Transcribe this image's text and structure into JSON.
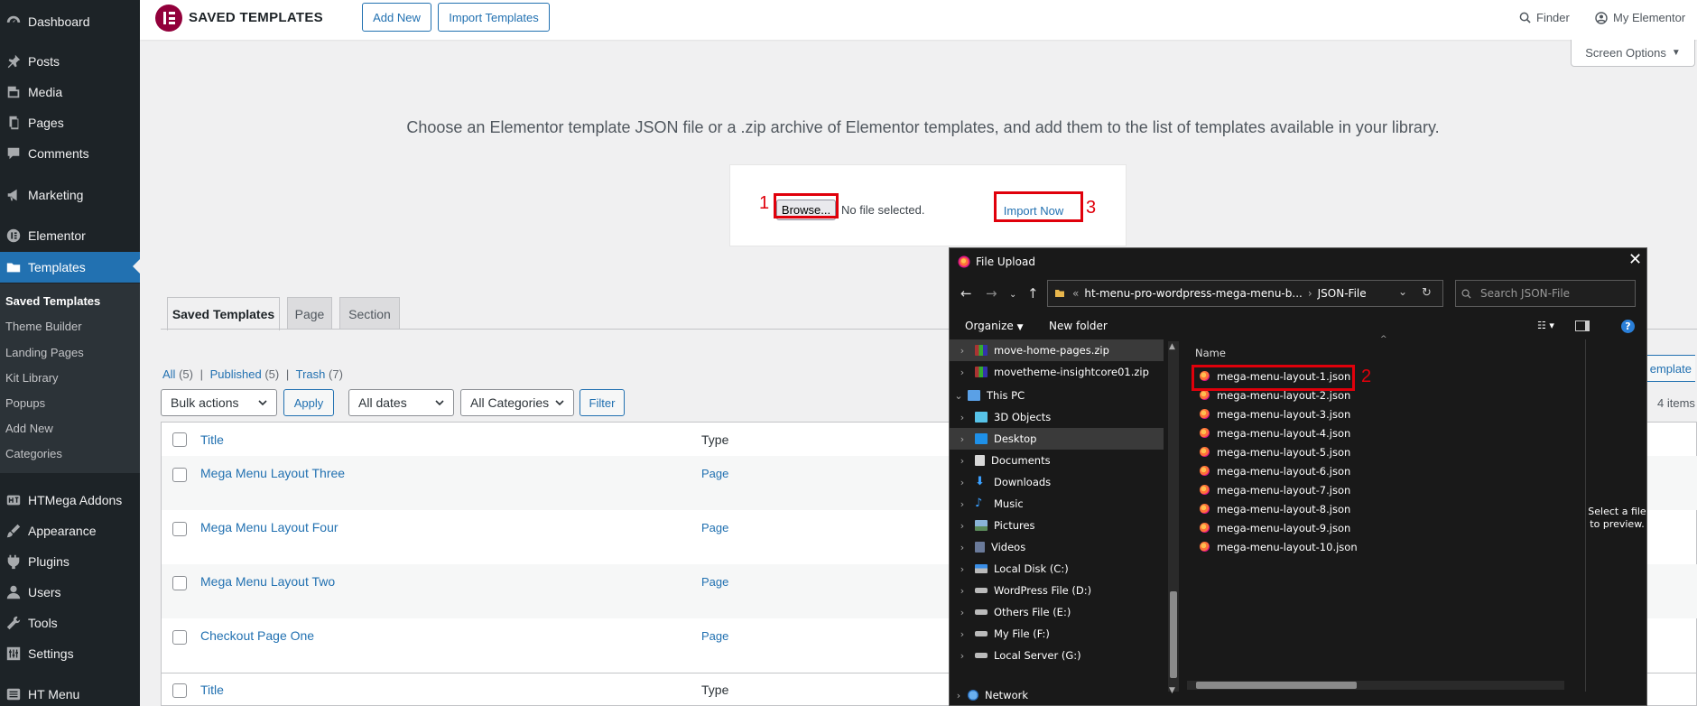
{
  "sidebar": {
    "items": [
      {
        "label": "Dashboard",
        "icon": "dashboard-icon"
      },
      {
        "label": "Posts",
        "icon": "pin-icon"
      },
      {
        "label": "Media",
        "icon": "media-icon"
      },
      {
        "label": "Pages",
        "icon": "pages-icon"
      },
      {
        "label": "Comments",
        "icon": "comment-icon"
      },
      {
        "label": "Marketing",
        "icon": "megaphone-icon"
      },
      {
        "label": "Elementor",
        "icon": "elementor-icon"
      },
      {
        "label": "Templates",
        "icon": "folder-icon"
      },
      {
        "label": "HTMega Addons",
        "icon": "htmega-icon"
      },
      {
        "label": "Appearance",
        "icon": "brush-icon"
      },
      {
        "label": "Plugins",
        "icon": "plug-icon"
      },
      {
        "label": "Users",
        "icon": "user-icon"
      },
      {
        "label": "Tools",
        "icon": "wrench-icon"
      },
      {
        "label": "Settings",
        "icon": "settings-icon"
      },
      {
        "label": "HT Menu",
        "icon": "menu-icon"
      }
    ],
    "submenu": [
      "Saved Templates",
      "Theme Builder",
      "Landing Pages",
      "Kit Library",
      "Popups",
      "Add New",
      "Categories"
    ]
  },
  "topbar": {
    "title": "SAVED TEMPLATES",
    "add_new": "Add New",
    "import_templates": "Import Templates",
    "finder": "Finder",
    "my_elementor": "My Elementor"
  },
  "screen_options": "Screen Options",
  "import": {
    "intro": "Choose an Elementor template JSON file or a .zip archive of Elementor templates, and add them to the list of templates available in your library.",
    "browse": "Browse...",
    "no_file": "No file selected.",
    "import_now": "Import Now"
  },
  "annotations": {
    "one": "1",
    "two": "2",
    "three": "3"
  },
  "tabs": [
    "Saved Templates",
    "Page",
    "Section"
  ],
  "filters": {
    "all": "All",
    "all_count": "(5)",
    "published": "Published",
    "published_count": "(5)",
    "trash": "Trash",
    "trash_count": "(7)",
    "sep": "|",
    "bulk_actions": "Bulk actions",
    "apply": "Apply",
    "all_dates": "All dates",
    "all_categories": "All Categories",
    "filter": "Filter"
  },
  "create_partial": "emplate",
  "items_count": "4 items",
  "table": {
    "col_title": "Title",
    "col_type": "Type",
    "rows": [
      {
        "title": "Mega Menu Layout Three",
        "type": "Page"
      },
      {
        "title": "Mega Menu Layout Four",
        "type": "Page"
      },
      {
        "title": "Mega Menu Layout Two",
        "type": "Page"
      },
      {
        "title": "Checkout Page One",
        "type": "Page"
      }
    ]
  },
  "dialog": {
    "title": "File Upload",
    "path_prefix": "«",
    "path_folder": "ht-menu-pro-wordpress-mega-menu-b...",
    "path_sep": "›",
    "path_current": "JSON-File",
    "search_placeholder": "Search JSON-File",
    "organize": "Organize",
    "new_folder": "New folder",
    "name_col": "Name",
    "preview": "Select a file to preview.",
    "tree": [
      {
        "label": "move-home-pages.zip",
        "kind": "zip"
      },
      {
        "label": "movetheme-insightcore01.zip",
        "kind": "zip"
      },
      {
        "label": "This PC",
        "kind": "pc"
      },
      {
        "label": "3D Objects",
        "kind": "cube"
      },
      {
        "label": "Desktop",
        "kind": "desktop"
      },
      {
        "label": "Documents",
        "kind": "doc"
      },
      {
        "label": "Downloads",
        "kind": "download"
      },
      {
        "label": "Music",
        "kind": "music"
      },
      {
        "label": "Pictures",
        "kind": "picture"
      },
      {
        "label": "Videos",
        "kind": "video"
      },
      {
        "label": "Local Disk (C:)",
        "kind": "disk"
      },
      {
        "label": "WordPress File (D:)",
        "kind": "drive"
      },
      {
        "label": "Others File (E:)",
        "kind": "drive"
      },
      {
        "label": "My File (F:)",
        "kind": "drive"
      },
      {
        "label": "Local Server (G:)",
        "kind": "drive"
      },
      {
        "label": "Network",
        "kind": "network"
      }
    ],
    "files": [
      "mega-menu-layout-1.json",
      "mega-menu-layout-2.json",
      "mega-menu-layout-3.json",
      "mega-menu-layout-4.json",
      "mega-menu-layout-5.json",
      "mega-menu-layout-6.json",
      "mega-menu-layout-7.json",
      "mega-menu-layout-8.json",
      "mega-menu-layout-9.json",
      "mega-menu-layout-10.json"
    ]
  },
  "colors": {
    "sidebar_bg": "#1d2327",
    "wp_blue": "#2271b1",
    "elementor_brand": "#92003b",
    "annotation_red": "#e0000b",
    "dialog_bg": "#191919"
  }
}
